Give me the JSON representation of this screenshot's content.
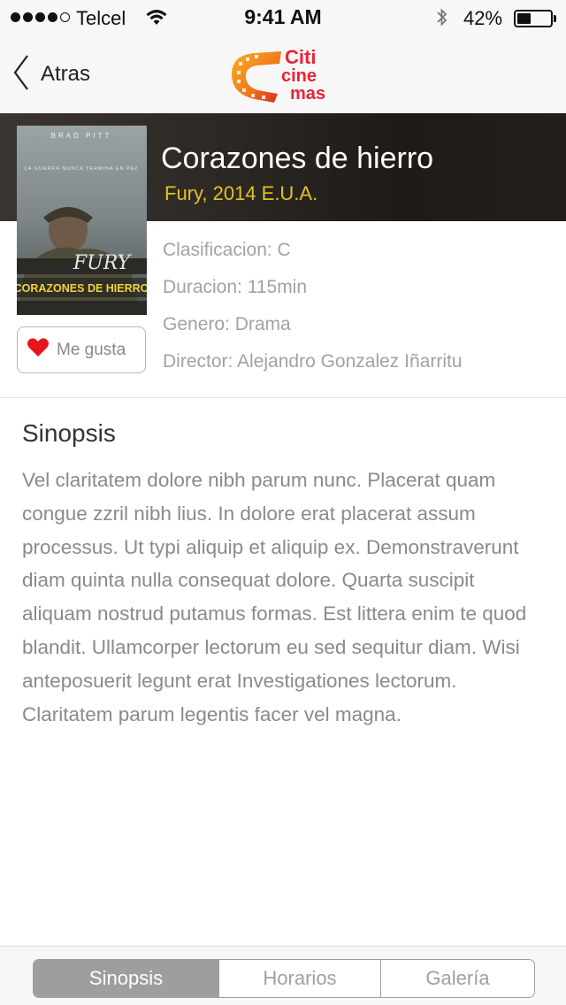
{
  "status_bar": {
    "carrier": "Telcel",
    "time": "9:41 AM",
    "battery_percent_label": "42%",
    "battery_level": 0.42,
    "signal_bars_filled": 4,
    "signal_bars_total": 5,
    "icons": [
      "signal-dots-icon",
      "wifi-icon",
      "bluetooth-icon",
      "battery-icon"
    ]
  },
  "nav": {
    "back_label": "Atras",
    "back_icon": "chevron-left-icon",
    "logo_text_line1": "Citi",
    "logo_text_line2": "cine",
    "logo_text_line3": "mas"
  },
  "movie": {
    "title": "Corazones de hierro",
    "subtitle": "Fury, 2014 E.U.A.",
    "poster": {
      "top_text": "BRAD PITT",
      "tagline": "LA GUERRA NUNCA TERMINA EN PAZ",
      "logo_text": "FURY",
      "spanish_title": "CORAZONES DE HIERRO"
    },
    "details": [
      "Clasificacion: C",
      "Duracion: 115min",
      "Genero: Drama",
      "Director: Alejandro Gonzalez Iñarritu"
    ]
  },
  "like_button": {
    "label": "Me gusta",
    "icon": "heart-icon"
  },
  "synopsis": {
    "heading": "Sinopsis",
    "body": "Vel claritatem dolore nibh parum nunc. Placerat quam congue zzril nibh lius. In dolore erat placerat assum processus. Ut typi aliquip et aliquip ex. Demonstraverunt diam quinta nulla consequat dolore. Quarta suscipit aliquam nostrud putamus formas. Est littera enim te quod blandit. Ullamcorper lectorum eu sed sequitur diam. Wisi anteposuerit legunt erat Investigationes lectorum. Claritatem parum legentis facer vel magna."
  },
  "tabs": [
    {
      "label": "Sinopsis",
      "active": true
    },
    {
      "label": "Horarios",
      "active": false
    },
    {
      "label": "Galería",
      "active": false
    }
  ],
  "colors": {
    "accent_yellow": "#e3c023",
    "heart_red": "#e8141c",
    "segment_gray": "#9e9e9e",
    "logo_red": "#e8233a",
    "logo_orange": "#f39a1e"
  }
}
